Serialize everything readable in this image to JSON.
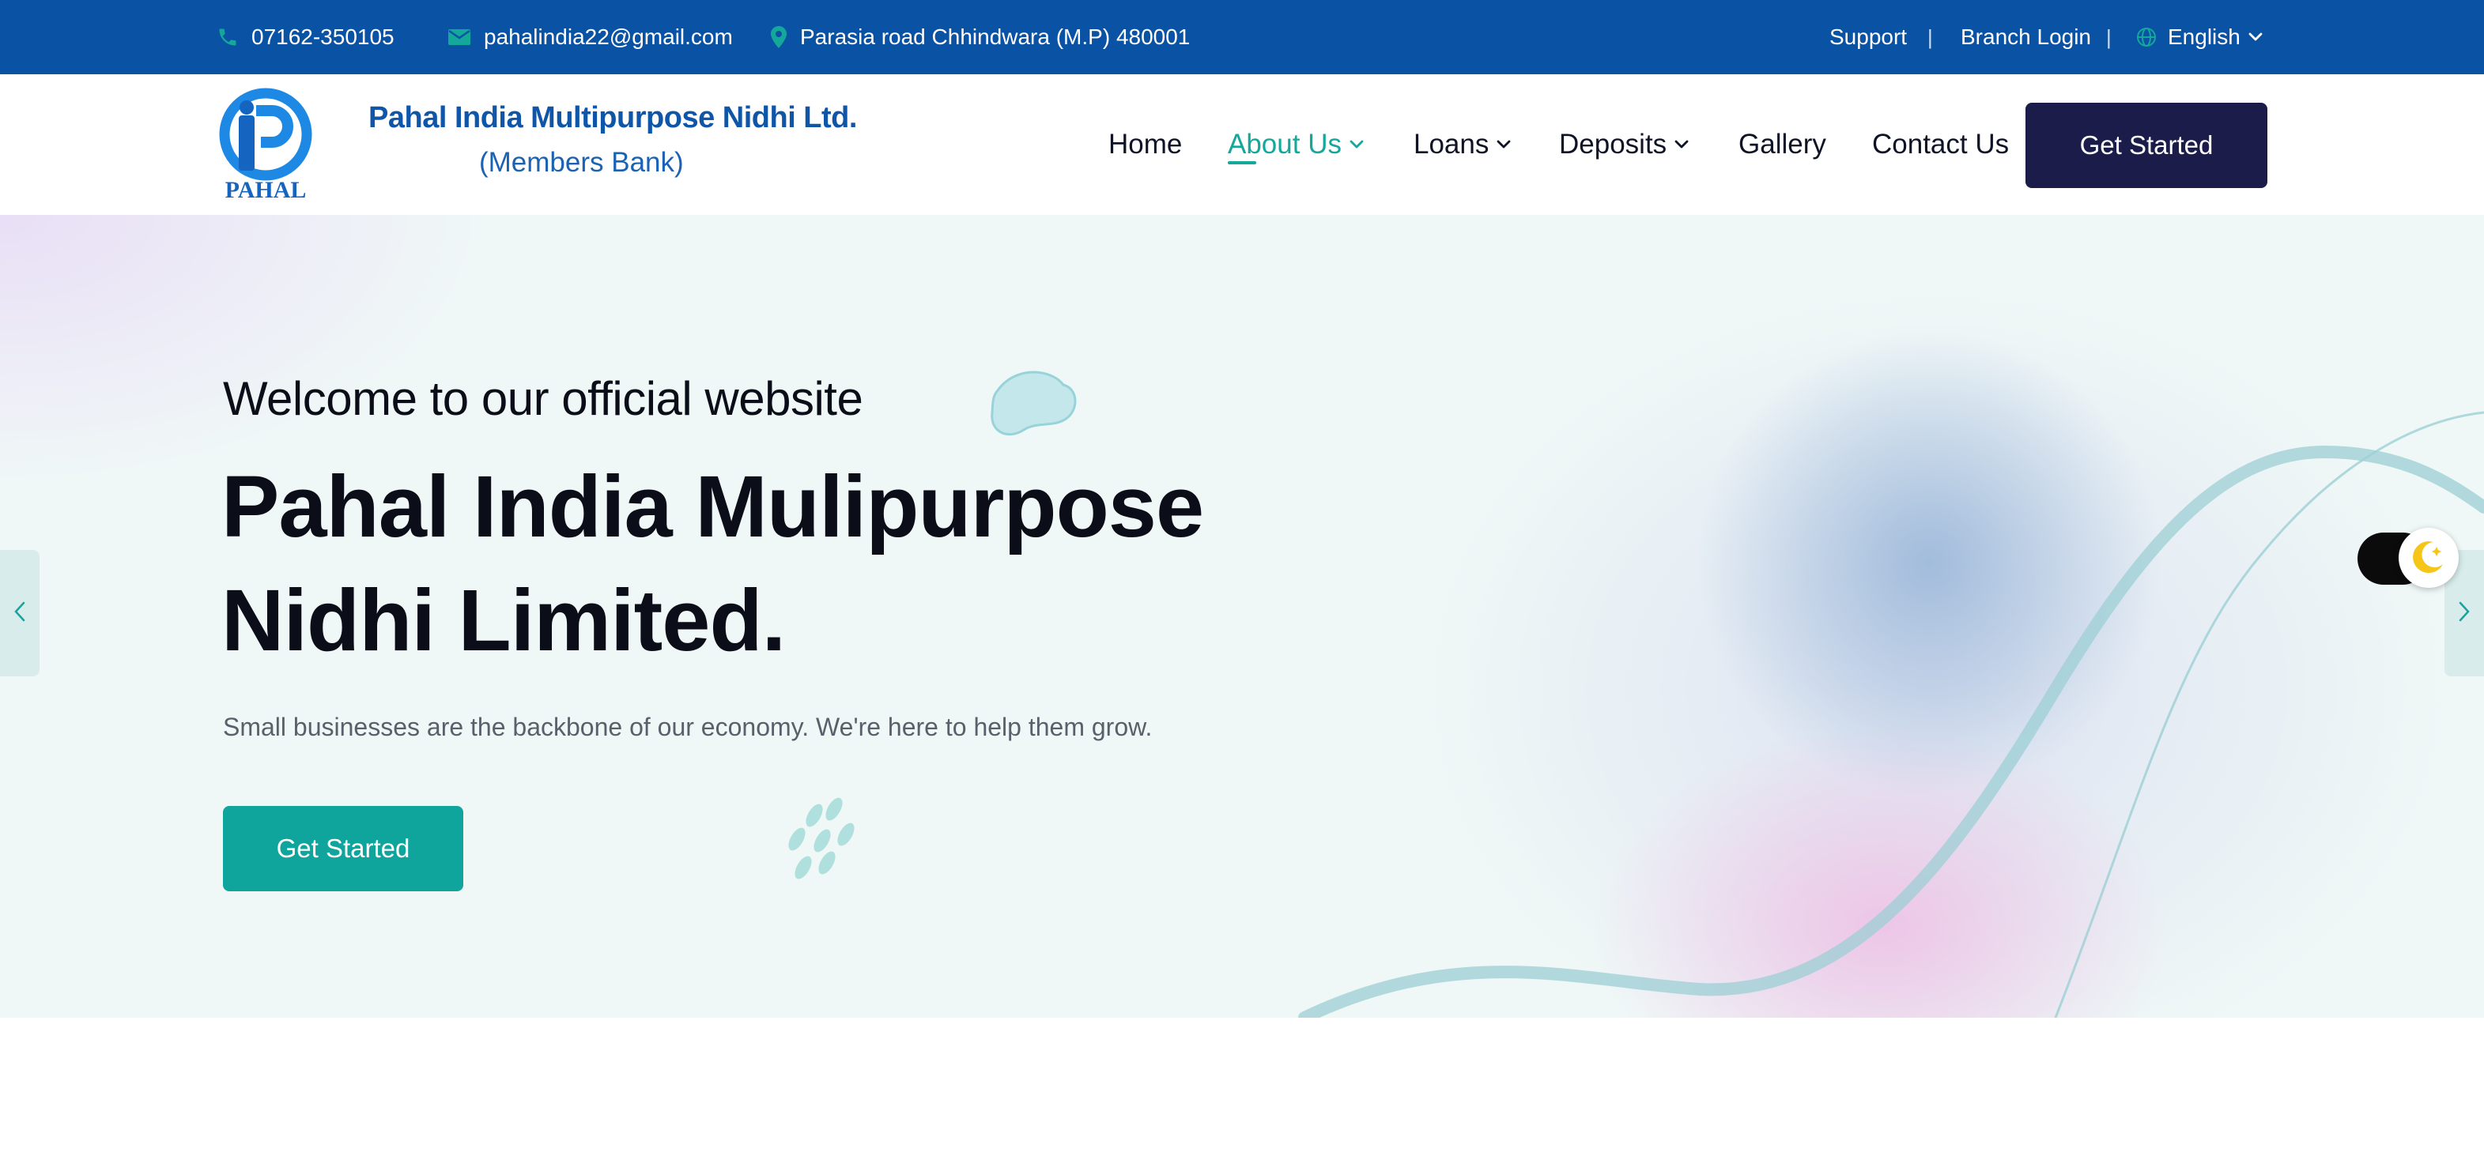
{
  "topbar": {
    "phone": "07162-350105",
    "email": "pahalindia22@gmail.com",
    "address": "Parasia road Chhindwara (M.P) 480001",
    "support": "Support",
    "separator": "|",
    "branch_login": "Branch Login",
    "language": "English",
    "icon_color": "#14a89b",
    "background": "#0a52a3"
  },
  "header": {
    "logo_text": "PAHAL",
    "brand_name": "Pahal India Multipurpose Nidhi Ltd.",
    "brand_subtitle": "(Members Bank)",
    "nav": [
      {
        "label": "Home"
      },
      {
        "label": "About Us",
        "active": true,
        "dropdown": true
      },
      {
        "label": "Loans",
        "dropdown": true
      },
      {
        "label": "Deposits",
        "dropdown": true
      },
      {
        "label": "Gallery"
      },
      {
        "label": "Contact Us"
      }
    ],
    "cta_label": "Get Started",
    "cta_color": "#1b1c4a"
  },
  "hero": {
    "welcome": "Welcome to our official website",
    "title": "Pahal India Mulipurpose Nidhi Limited.",
    "subtitle": "Small businesses are the backbone of our economy. We're here to help them grow.",
    "cta_label": "Get Started",
    "cta_color": "#0fa59c",
    "prev_icon": "chevron-left-icon",
    "next_icon": "chevron-right-icon",
    "theme_toggle_icon": "moon-icon"
  }
}
